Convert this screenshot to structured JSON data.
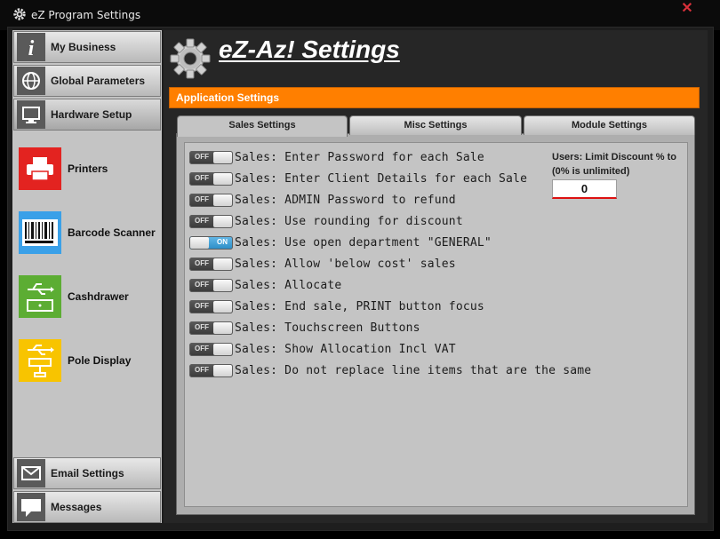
{
  "window": {
    "title": "eZ Program Settings",
    "close_glyph": "✕"
  },
  "header": {
    "title": "eZ-Az! Settings"
  },
  "sidebar": {
    "top_items": [
      {
        "label": "My Business",
        "icon": "info-icon"
      },
      {
        "label": "Global Parameters",
        "icon": "globe-icon"
      },
      {
        "label": "Hardware Setup",
        "icon": "monitor-icon"
      }
    ],
    "hardware_items": [
      {
        "label": "Printers",
        "icon": "printer-icon",
        "color": "#e32320"
      },
      {
        "label": "Barcode Scanner",
        "icon": "barcode-icon",
        "color": "#3aa0e8"
      },
      {
        "label": "Cashdrawer",
        "icon": "usb-cashdrawer-icon",
        "color": "#5cad33"
      },
      {
        "label": "Pole Display",
        "icon": "usb-pole-display-icon",
        "color": "#f8c400"
      }
    ],
    "bottom_items": [
      {
        "label": "Email Settings",
        "icon": "envelope-icon"
      },
      {
        "label": "Messages",
        "icon": "chat-icon"
      }
    ]
  },
  "section_bar": {
    "label": "Application Settings",
    "color": "#ff7f00"
  },
  "tabs": [
    {
      "label": "Sales Settings",
      "active": true
    },
    {
      "label": "Misc Settings",
      "active": false
    },
    {
      "label": "Module Settings",
      "active": false
    }
  ],
  "toggle_text": {
    "off": "OFF",
    "on": "ON"
  },
  "settings": [
    {
      "label": "Sales: Enter Password for each Sale",
      "state": "off"
    },
    {
      "label": "Sales: Enter Client Details for each Sale",
      "state": "off"
    },
    {
      "label": "Sales: ADMIN Password to refund",
      "state": "off"
    },
    {
      "label": "Sales: Use rounding for discount",
      "state": "off"
    },
    {
      "label": "Sales: Use open department \"GENERAL\"",
      "state": "on"
    },
    {
      "label": "Sales: Allow 'below cost' sales",
      "state": "off"
    },
    {
      "label": "Sales: Allocate",
      "state": "off"
    },
    {
      "label": "Sales: End sale, PRINT button focus",
      "state": "off"
    },
    {
      "label": "Sales: Touchscreen Buttons",
      "state": "off"
    },
    {
      "label": "Sales: Show Allocation Incl VAT",
      "state": "off"
    },
    {
      "label": "Sales: Do not replace line items that are the same",
      "state": "off"
    }
  ],
  "discount_limit": {
    "label": "Users: Limit Discount % to (0% is unlimited)",
    "value": "0"
  }
}
